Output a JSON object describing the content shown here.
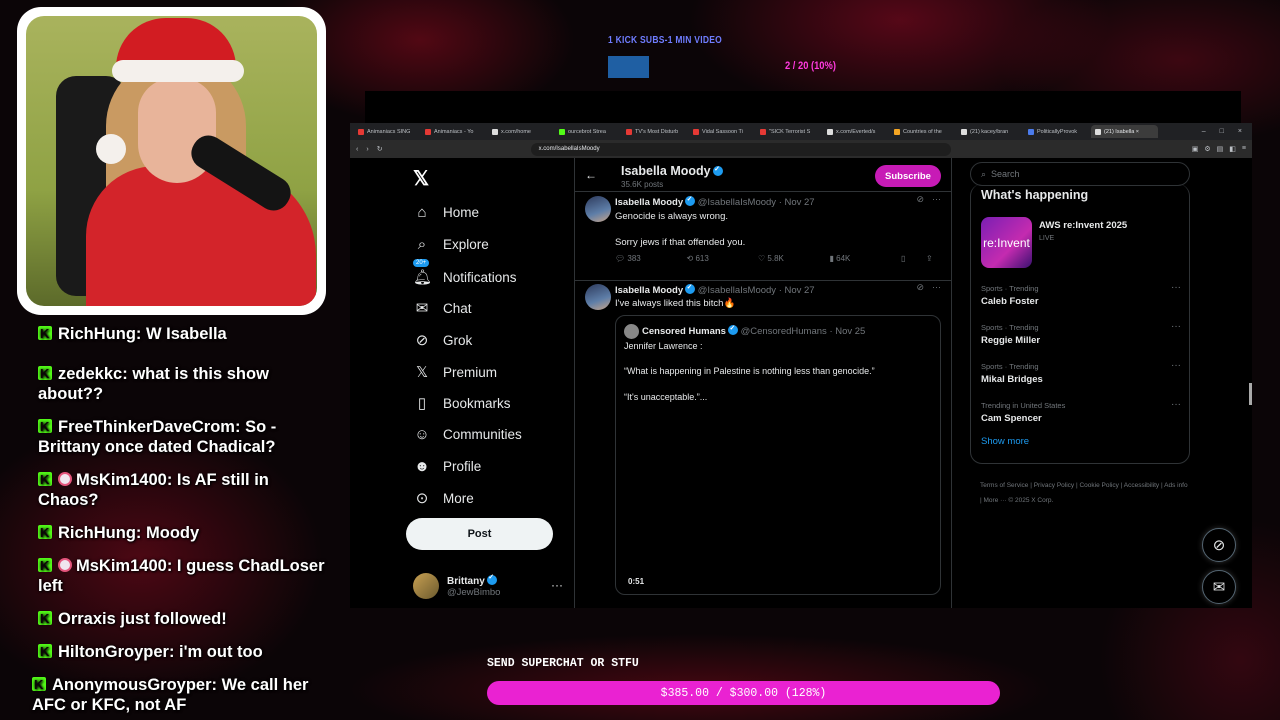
{
  "overlay": {
    "sub_goal_label": "1 KICK SUBS-1 MIN VIDEO",
    "sub_goal_count": "2 / 20 (10%)",
    "superchat_label": "SEND SUPERCHAT OR STFU",
    "superchat_progress_text": "$385.00 / $300.00 (128%)",
    "superchat_progress_fraction": 1.0,
    "accent_color": "#ea22d2"
  },
  "chat": {
    "messages": [
      {
        "user": "RichHung",
        "text": "W Isabella"
      },
      {
        "user": "zedekkc",
        "text": "what is this show about??"
      },
      {
        "user": "FreeThinkerDaveCrom",
        "text": "So - Brittany once dated Chadical?"
      },
      {
        "user": "MsKim1400",
        "text": "Is AF still in Chaos?"
      },
      {
        "user": "RichHung",
        "text": "Moody"
      },
      {
        "user": "MsKim1400",
        "text": "I guess ChadLoser left"
      },
      {
        "system": "Orraxis just followed!"
      },
      {
        "user": "HiltonGroyper",
        "text": "i'm out too"
      },
      {
        "user": "AnonymousGroyper",
        "text": "We call her AFC or KFC, not AF"
      }
    ]
  },
  "browser": {
    "tabs": [
      "Animaniacs SING",
      "Animaniacs - Yo",
      "x.com/home",
      "ourcebrot Strea",
      "TV's Most Disturb",
      "Vidal Sassoon Ti",
      "\"SICK Terrorist S",
      "x.com/Everted/s",
      "Countries of the",
      "(21) kacey/bran",
      "PoliticallyProvok",
      "(21) Isabella"
    ],
    "url": "x.com/IsabellaIsMoody"
  },
  "nav": {
    "items": [
      "Home",
      "Explore",
      "Notifications",
      "Chat",
      "Grok",
      "Premium",
      "Bookmarks",
      "Communities",
      "Profile",
      "More"
    ],
    "notif_badge": "20+",
    "post_label": "Post",
    "account_name": "Brittany",
    "account_handle": "@JewBimbo"
  },
  "profile": {
    "name": "Isabella Moody",
    "posts": "35.6K posts",
    "subscribe_label": "Subscribe"
  },
  "tweets": [
    {
      "name": "Isabella Moody",
      "handle": "@IsabellaIsMoody",
      "date": "· Nov 27",
      "line1": "Genocide is always wrong.",
      "line2": "Sorry jews if that offended you.",
      "replies": "383",
      "reposts": "613",
      "likes": "5.8K",
      "views": "64K"
    },
    {
      "name": "Isabella Moody",
      "handle": "@IsabellaIsMoody",
      "date": "· Nov 27",
      "line1": "I've always liked this bitch🔥",
      "quote": {
        "name": "Censored Humans",
        "handle": "@CensoredHumans",
        "date": "· Nov 25",
        "line1": "Jennifer Lawrence :",
        "line2": "“What is happening in Palestine is nothing less than genocide.”",
        "line3": "“It's unacceptable.”...",
        "duration": "0:51"
      }
    }
  ],
  "sidebar": {
    "search_placeholder": "Search",
    "title": "What's happening",
    "featured": {
      "image_text": "re:Invent",
      "title": "AWS re:Invent 2025",
      "status": "LIVE"
    },
    "trends": [
      {
        "category": "Sports · Trending",
        "name": "Caleb Foster"
      },
      {
        "category": "Sports · Trending",
        "name": "Reggie Miller"
      },
      {
        "category": "Sports · Trending",
        "name": "Mikal Bridges"
      },
      {
        "category": "Trending in United States",
        "name": "Cam Spencer"
      }
    ],
    "show_more": "Show more",
    "footer": "Terms of Service  |  Privacy Policy  |  Cookie Policy  |  Accessibility  |  Ads info  |  More ···  © 2025 X Corp."
  }
}
